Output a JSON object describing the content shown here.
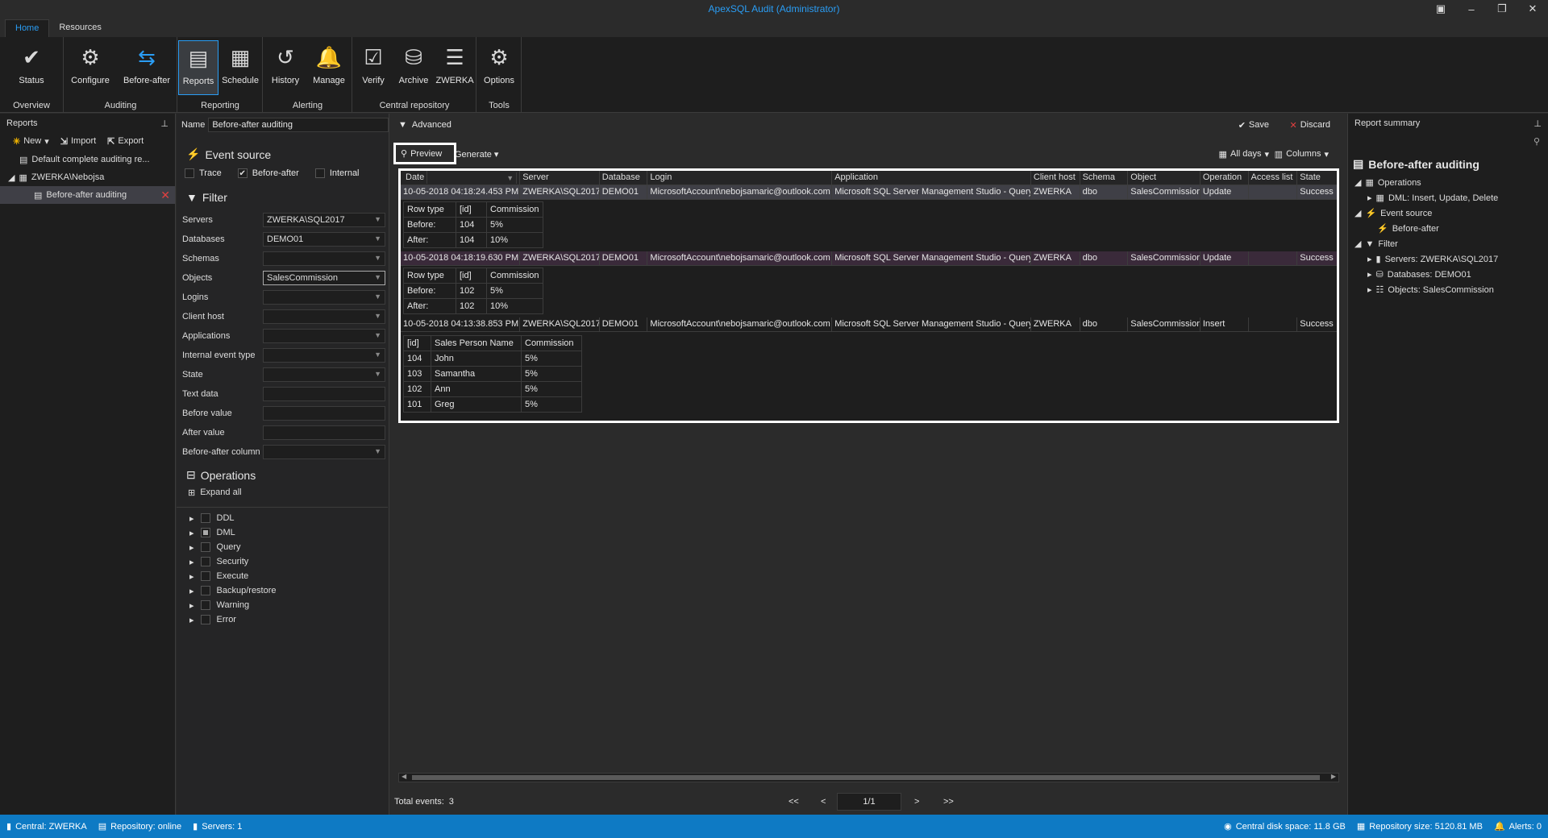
{
  "app": {
    "title": "ApexSQL Audit (Administrator)",
    "tabs": [
      "Home",
      "Resources"
    ]
  },
  "ribbon": {
    "groups": [
      {
        "label": "Overview",
        "buttons": [
          {
            "label": "Status",
            "icon": "check-icon"
          }
        ]
      },
      {
        "label": "Auditing",
        "buttons": [
          {
            "label": "Configure",
            "icon": "configure-icon"
          },
          {
            "label": "Before-after",
            "icon": "swap-arrows-icon"
          }
        ]
      },
      {
        "label": "Reporting",
        "buttons": [
          {
            "label": "Reports",
            "icon": "report-icon"
          },
          {
            "label": "Schedule",
            "icon": "calendar-icon"
          }
        ]
      },
      {
        "label": "Alerting",
        "buttons": [
          {
            "label": "History",
            "icon": "history-icon"
          },
          {
            "label": "Manage",
            "icon": "manage-alerts-icon"
          }
        ]
      },
      {
        "label": "Central repository",
        "buttons": [
          {
            "label": "Verify",
            "icon": "verify-icon"
          },
          {
            "label": "Archive",
            "icon": "archive-icon"
          },
          {
            "label": "ZWERKA",
            "icon": "server-icon"
          }
        ]
      },
      {
        "label": "Tools",
        "buttons": [
          {
            "label": "Options",
            "icon": "gear-icon"
          }
        ]
      }
    ]
  },
  "left": {
    "title": "Reports",
    "toolbar": {
      "new": "New",
      "import": "Import",
      "export": "Export"
    },
    "tree": {
      "item1": "Default complete auditing re...",
      "item2": "ZWERKA\\Nebojsa",
      "item3": "Before-after auditing"
    }
  },
  "filter": {
    "name_label": "Name",
    "name_value": "Before-after auditing",
    "event_source": "Event source",
    "es_trace": "Trace",
    "es_before_after": "Before-after",
    "es_internal": "Internal",
    "filter_title": "Filter",
    "fields": [
      {
        "label": "Servers",
        "value": "ZWERKA\\SQL2017"
      },
      {
        "label": "Databases",
        "value": "DEMO01"
      },
      {
        "label": "Schemas",
        "value": ""
      },
      {
        "label": "Objects",
        "value": "SalesCommission"
      },
      {
        "label": "Logins",
        "value": ""
      },
      {
        "label": "Client host",
        "value": ""
      },
      {
        "label": "Applications",
        "value": ""
      },
      {
        "label": "Internal event type",
        "value": ""
      },
      {
        "label": "State",
        "value": ""
      },
      {
        "label": "Text data",
        "value": ""
      },
      {
        "label": "Before value",
        "value": ""
      },
      {
        "label": "After value",
        "value": ""
      },
      {
        "label": "Before-after column",
        "value": ""
      }
    ],
    "operations_title": "Operations",
    "expand_all": "Expand all",
    "ops": [
      "DDL",
      "DML",
      "Query",
      "Security",
      "Execute",
      "Backup/restore",
      "Warning",
      "Error"
    ]
  },
  "main": {
    "advanced": "Advanced",
    "save": "Save",
    "discard": "Discard",
    "preview": "Preview",
    "generate": "Generate",
    "all_days": "All days",
    "columns": "Columns",
    "headers": [
      "Date",
      "Server",
      "Database",
      "Login",
      "Application",
      "Client host",
      "Schema",
      "Object",
      "Operation",
      "Access list",
      "State"
    ],
    "rows": [
      {
        "date": "10-05-2018 04:18:24.453 PM",
        "server": "ZWERKA\\SQL2017",
        "db": "DEMO01",
        "login": "MicrosoftAccount\\nebojsamaric@outlook.com",
        "app": "Microsoft SQL Server Management Studio - Query",
        "host": "ZWERKA",
        "schema": "dbo",
        "object": "SalesCommission",
        "op": "Update",
        "access": "",
        "state": "Success"
      },
      {
        "date": "10-05-2018 04:18:19.630 PM",
        "server": "ZWERKA\\SQL2017",
        "db": "DEMO01",
        "login": "MicrosoftAccount\\nebojsamaric@outlook.com",
        "app": "Microsoft SQL Server Management Studio - Query",
        "host": "ZWERKA",
        "schema": "dbo",
        "object": "SalesCommission",
        "op": "Update",
        "access": "",
        "state": "Success"
      },
      {
        "date": "10-05-2018 04:13:38.853 PM",
        "server": "ZWERKA\\SQL2017",
        "db": "DEMO01",
        "login": "MicrosoftAccount\\nebojsamaric@outlook.com",
        "app": "Microsoft SQL Server Management Studio - Query",
        "host": "ZWERKA",
        "schema": "dbo",
        "object": "SalesCommission",
        "op": "Insert",
        "access": "",
        "state": "Success"
      }
    ],
    "sub1": {
      "h": [
        "Row type",
        "[id]",
        "Commission"
      ],
      "r1": [
        "Before:",
        "104",
        "5%"
      ],
      "r2": [
        "After:",
        "104",
        "10%"
      ]
    },
    "sub2": {
      "h": [
        "Row type",
        "[id]",
        "Commission"
      ],
      "r1": [
        "Before:",
        "102",
        "5%"
      ],
      "r2": [
        "After:",
        "102",
        "10%"
      ]
    },
    "sub3": {
      "h": [
        "[id]",
        "Sales Person Name",
        "Commission"
      ],
      "rows": [
        [
          "104",
          "John",
          "5%"
        ],
        [
          "103",
          "Samantha",
          "5%"
        ],
        [
          "102",
          "Ann",
          "5%"
        ],
        [
          "101",
          "Greg",
          "5%"
        ]
      ]
    },
    "total_label": "Total events:",
    "total": "3",
    "pager": {
      "first": "<<",
      "prev": "<",
      "page": "1/1",
      "next": ">",
      "last": ">>"
    }
  },
  "summary": {
    "title": "Report summary",
    "heading": "Before-after auditing",
    "operations": "Operations",
    "dml": "DML: Insert, Update, Delete",
    "event_source": "Event source",
    "before_after": "Before-after",
    "filter": "Filter",
    "servers": "Servers: ZWERKA\\SQL2017",
    "databases": "Databases: DEMO01",
    "objects": "Objects: SalesCommission"
  },
  "status": {
    "central": "Central: ZWERKA",
    "repo": "Repository: online",
    "servers": "Servers: 1",
    "disk": "Central disk space: 11.8 GB",
    "repo_size": "Repository size: 5120.81 MB",
    "alerts": "Alerts: 0"
  },
  "colors": {
    "accent": "#2a9df4",
    "statusbar": "#0e7ac4",
    "delete": "#e04040",
    "highlight_row": "#3a2a3a"
  }
}
